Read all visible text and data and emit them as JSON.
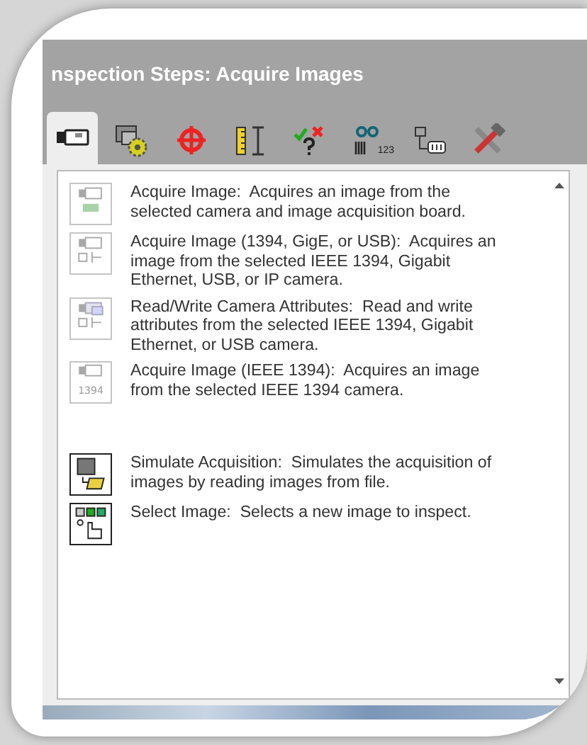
{
  "window": {
    "title": "nspection Steps: Acquire Images"
  },
  "tabs": [
    {
      "kind": "camera",
      "selected": true
    },
    {
      "kind": "gear",
      "selected": false
    },
    {
      "kind": "crosshair",
      "selected": false
    },
    {
      "kind": "ruler",
      "selected": false
    },
    {
      "kind": "check",
      "selected": false
    },
    {
      "kind": "barcode",
      "selected": false,
      "icon_text": "123"
    },
    {
      "kind": "io",
      "selected": false
    },
    {
      "kind": "tools",
      "selected": false
    }
  ],
  "steps": [
    {
      "kind": "board",
      "disabled": true,
      "text": "Acquire Image:  Acquires an image from the selected camera and image acquisition board."
    },
    {
      "kind": "network",
      "disabled": true,
      "text": "Acquire Image (1394, GigE, or USB):  Acquires an image from the selected IEEE 1394, Gigabit Ethernet, USB, or IP camera."
    },
    {
      "kind": "attributes",
      "disabled": true,
      "text": "Read/Write Camera Attributes:  Read and write attributes from the selected IEEE 1394, Gigabit Ethernet, or USB camera."
    },
    {
      "kind": "firewire",
      "disabled": true,
      "icon_text": "1394",
      "text": "Acquire Image (IEEE 1394):  Acquires an image from the selected IEEE 1394 camera."
    },
    {
      "kind": "simulate",
      "disabled": false,
      "text": "Simulate Acquisition:  Simulates the acquisition of images by reading images from file."
    },
    {
      "kind": "select",
      "disabled": false,
      "text": "Select Image:  Selects a new image to inspect."
    }
  ]
}
